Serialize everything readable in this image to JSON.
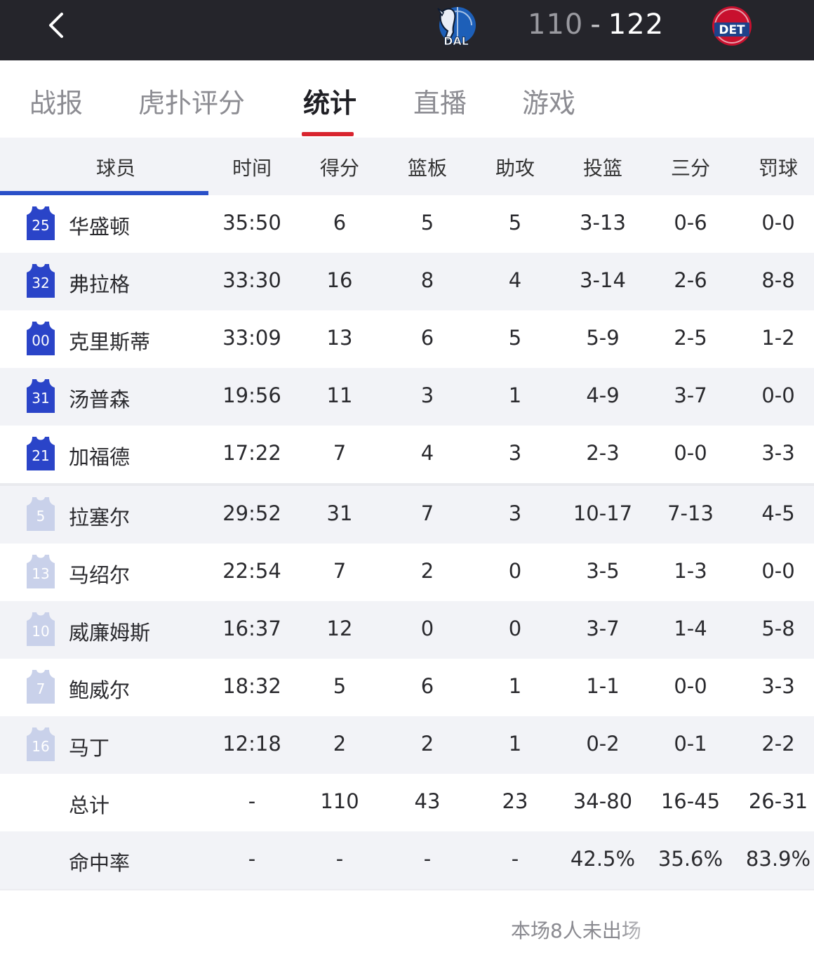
{
  "header": {
    "back_icon": "chevron-left-icon",
    "home_team": {
      "abbr": "DAL",
      "logo_icon": "mavericks-logo",
      "color": "#1d5fb8"
    },
    "away_team": {
      "abbr": "DET",
      "logo_icon": "pistons-logo",
      "color": "#c8102e"
    },
    "home_score": "110",
    "separator": "-",
    "away_score": "122"
  },
  "tabs": [
    {
      "label": "战报",
      "active": false
    },
    {
      "label": "虎扑评分",
      "active": false
    },
    {
      "label": "统计",
      "active": true
    },
    {
      "label": "直播",
      "active": false
    },
    {
      "label": "游戏",
      "active": false
    }
  ],
  "accent_color": "#d9242f",
  "table": {
    "columns": [
      "球员",
      "时间",
      "得分",
      "篮板",
      "助攻",
      "投篮",
      "三分",
      "罚球"
    ],
    "starters": [
      {
        "number": "25",
        "name": "华盛顿",
        "time": "35:50",
        "pts": "6",
        "reb": "5",
        "ast": "5",
        "fg": "3-13",
        "tp": "0-6",
        "ft": "0-0"
      },
      {
        "number": "32",
        "name": "弗拉格",
        "time": "33:30",
        "pts": "16",
        "reb": "8",
        "ast": "4",
        "fg": "3-14",
        "tp": "2-6",
        "ft": "8-8"
      },
      {
        "number": "00",
        "name": "克里斯蒂",
        "time": "33:09",
        "pts": "13",
        "reb": "6",
        "ast": "5",
        "fg": "5-9",
        "tp": "2-5",
        "ft": "1-2"
      },
      {
        "number": "31",
        "name": "汤普森",
        "time": "19:56",
        "pts": "11",
        "reb": "3",
        "ast": "1",
        "fg": "4-9",
        "tp": "3-7",
        "ft": "0-0"
      },
      {
        "number": "21",
        "name": "加福德",
        "time": "17:22",
        "pts": "7",
        "reb": "4",
        "ast": "3",
        "fg": "2-3",
        "tp": "0-0",
        "ft": "3-3"
      }
    ],
    "bench": [
      {
        "number": "5",
        "name": "拉塞尔",
        "time": "29:52",
        "pts": "31",
        "reb": "7",
        "ast": "3",
        "fg": "10-17",
        "tp": "7-13",
        "ft": "4-5"
      },
      {
        "number": "13",
        "name": "马绍尔",
        "time": "22:54",
        "pts": "7",
        "reb": "2",
        "ast": "0",
        "fg": "3-5",
        "tp": "1-3",
        "ft": "0-0"
      },
      {
        "number": "10",
        "name": "威廉姆斯",
        "time": "16:37",
        "pts": "12",
        "reb": "0",
        "ast": "0",
        "fg": "3-7",
        "tp": "1-4",
        "ft": "5-8"
      },
      {
        "number": "7",
        "name": "鲍威尔",
        "time": "18:32",
        "pts": "5",
        "reb": "6",
        "ast": "1",
        "fg": "1-1",
        "tp": "0-0",
        "ft": "3-3"
      },
      {
        "number": "16",
        "name": "马丁",
        "time": "12:18",
        "pts": "2",
        "reb": "2",
        "ast": "1",
        "fg": "0-2",
        "tp": "0-1",
        "ft": "2-2"
      }
    ],
    "totals": {
      "label": "总计",
      "time": "-",
      "pts": "110",
      "reb": "43",
      "ast": "23",
      "fg": "34-80",
      "tp": "16-45",
      "ft": "26-31"
    },
    "percentages": {
      "label": "命中率",
      "time": "-",
      "pts": "-",
      "reb": "-",
      "ast": "-",
      "fg": "42.5%",
      "tp": "35.6%",
      "ft": "83.9%"
    }
  },
  "footer": {
    "note": "本场8人未出场"
  },
  "colors": {
    "starter_jersey": "#2a44c8",
    "bench_jersey": "#c9d1ea",
    "topbar": "#25252b",
    "header_underline": "#2a50c8"
  }
}
